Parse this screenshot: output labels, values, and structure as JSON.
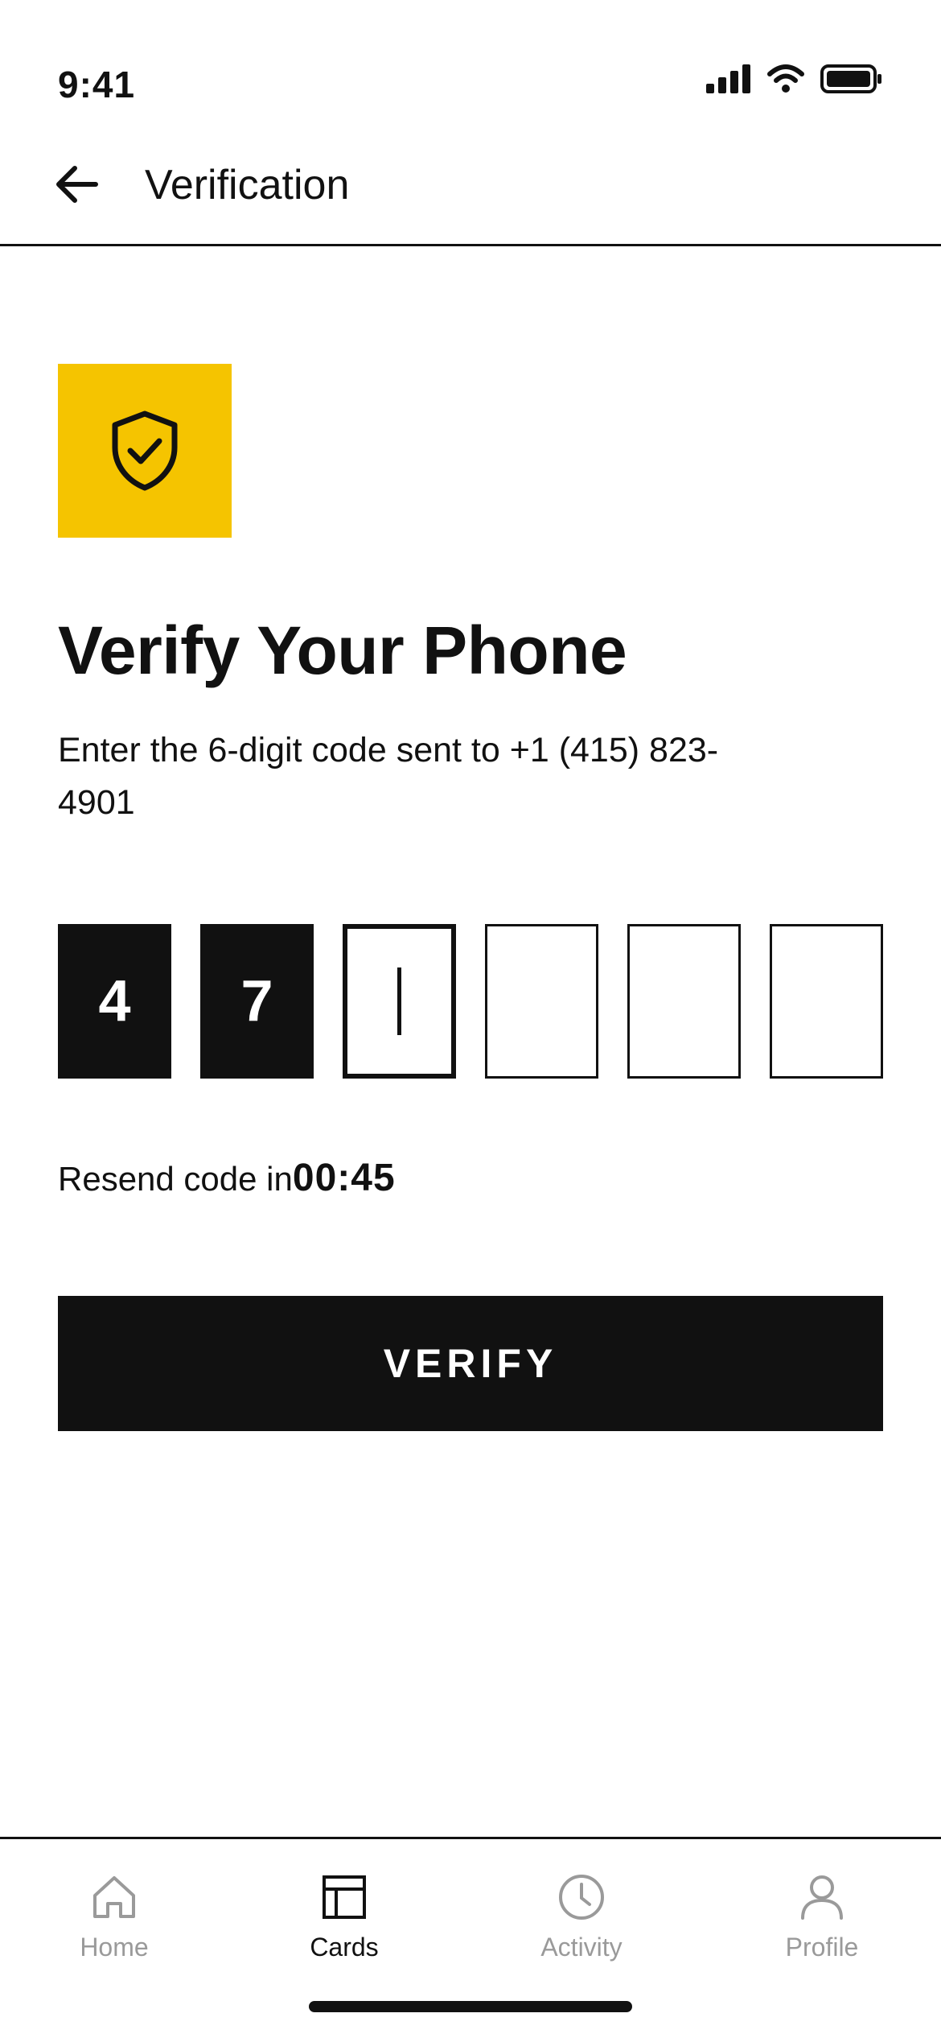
{
  "status_bar": {
    "time": "9:41"
  },
  "header": {
    "title": "Verification"
  },
  "main": {
    "title": "Verify Your Phone",
    "instruction": "Enter the 6-digit code sent to +1 (415) 823-4901",
    "code": [
      "4",
      "7",
      "",
      "",
      "",
      ""
    ],
    "active_index": 2,
    "resend_label": "Resend code in",
    "resend_timer": "00:45",
    "verify_label": "VERIFY"
  },
  "colors": {
    "accent": "#F5C400",
    "ink": "#111111",
    "muted": "#9A9A9A"
  },
  "nav": {
    "items": [
      {
        "label": "Home",
        "icon": "home-icon",
        "active": false
      },
      {
        "label": "Cards",
        "icon": "cards-icon",
        "active": true
      },
      {
        "label": "Activity",
        "icon": "clock-icon",
        "active": false
      },
      {
        "label": "Profile",
        "icon": "user-icon",
        "active": false
      }
    ]
  }
}
